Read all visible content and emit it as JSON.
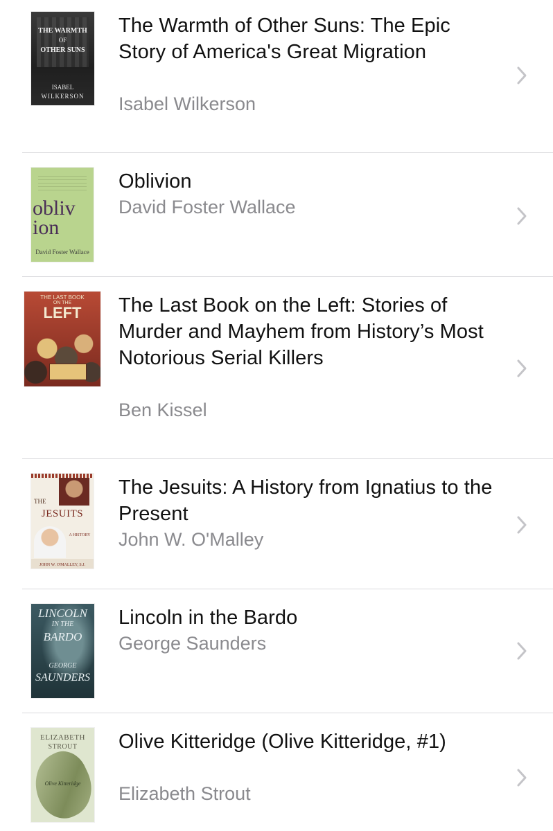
{
  "books": [
    {
      "title": "The Warmth of Other Suns: The Epic Story of America's Great Migration",
      "author": "Isabel Wilkerson",
      "cover": {
        "line1": "THE WARMTH",
        "line2": "OF",
        "line3": "OTHER SUNS",
        "line4": "ISABEL",
        "line5": "WILKERSON"
      }
    },
    {
      "title": "Oblivion",
      "author": "David Foster Wallace",
      "cover": {
        "line1": "obliv",
        "line2": "ion",
        "line3": "David Foster Wallace"
      }
    },
    {
      "title": "The Last Book on the Left: Stories of Murder and Mayhem from History’s Most Notorious Serial Killers",
      "author": "Ben Kissel",
      "cover": {
        "line1": "THE LAST BOOK",
        "line2": "ON THE",
        "line3": "LEFT"
      }
    },
    {
      "title": "The Jesuits: A History from Ignatius to the Present",
      "author": "John W. O'Malley",
      "cover": {
        "line1": "THE",
        "line2": "JESUITS",
        "line3": "A HISTORY",
        "line4": "JOHN W. O'MALLEY, S.J."
      }
    },
    {
      "title": "Lincoln in the Bardo",
      "author": "George Saunders",
      "cover": {
        "line1": "LINCOLN",
        "line2": "IN THE",
        "line3": "BARDO",
        "line4": "GEORGE",
        "line5": "SAUNDERS"
      }
    },
    {
      "title": "Olive Kitteridge (Olive Kitteridge, #1)",
      "author": "Elizabeth Strout",
      "cover": {
        "line1": "ELIZABETH",
        "line2": "STROUT",
        "line3": "Olive Kitteridge"
      }
    }
  ],
  "colors": {
    "title": "#111111",
    "author": "#8a8a8e",
    "separator": "#d9d9dc",
    "chevron": "#c4c4c8"
  },
  "icons": {
    "disclosure": "chevron-right-icon"
  }
}
